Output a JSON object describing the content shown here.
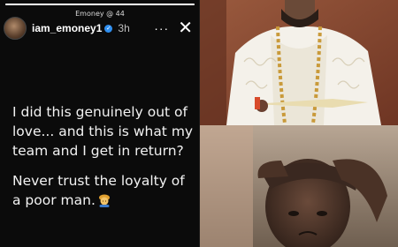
{
  "watermark": "Emoney @ 44",
  "story": {
    "progress": 1.0,
    "username": "iam_emoney1",
    "verified_glyph": "✓",
    "time": "3h",
    "more_glyph": "···",
    "close_glyph": "✕",
    "caption_lines": [
      "I did this genuinely out of love... and this is what my team and I get in return?",
      "Never trust the loyalty of a poor man."
    ],
    "emoji": "man-with-turban-emoji"
  },
  "photos": {
    "top": "man-in-white-agbada-with-coral-beads",
    "bottom": "man-holding-head-in-distress"
  }
}
